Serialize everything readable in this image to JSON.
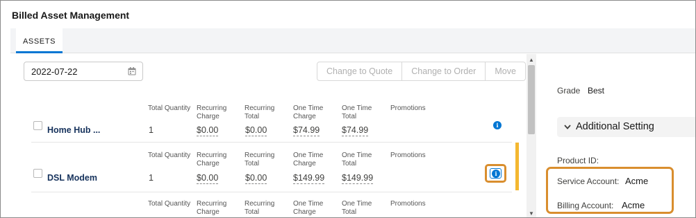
{
  "app": {
    "title": "Billed Asset Management"
  },
  "tabs": [
    {
      "label": "ASSETS"
    }
  ],
  "toolbar": {
    "date_value": "2022-07-22",
    "change_to_quote_label": "Change to Quote",
    "change_to_order_label": "Change to Order",
    "move_label": "Move"
  },
  "columns": {
    "total_quantity": "Total Quantity",
    "recurring_charge": [
      "Recurring",
      "Charge"
    ],
    "recurring_total": [
      "Recurring",
      "Total"
    ],
    "one_time_charge": [
      "One Time",
      "Charge"
    ],
    "one_time_total": [
      "One Time",
      "Total"
    ],
    "promotions": "Promotions"
  },
  "assets": [
    {
      "name": "Home Hub ...",
      "quantity": "1",
      "recurring_charge": "$0.00",
      "recurring_total": "$0.00",
      "one_time_charge": "$74.99",
      "one_time_total": "$74.99"
    },
    {
      "name": "DSL Modem",
      "quantity": "1",
      "recurring_charge": "$0.00",
      "recurring_total": "$0.00",
      "one_time_charge": "$149.99",
      "one_time_total": "$149.99"
    }
  ],
  "details": {
    "grade_label": "Grade",
    "grade_value": "Best",
    "section_title": "Additional Setting",
    "product_id_label": "Product ID:",
    "service_account_label": "Service Account:",
    "service_account_value": "Acme",
    "billing_account_label": "Billing Account:",
    "billing_account_value": "Acme"
  },
  "colors": {
    "accent": "#0176d3",
    "highlight": "#d98e2e",
    "active_row_marker": "#f4b730",
    "asset_name": "#16325c"
  },
  "icons": [
    "calendar-icon",
    "info-icon",
    "chevron-down-icon",
    "scroll-up-arrow-icon",
    "scroll-down-arrow-icon"
  ]
}
